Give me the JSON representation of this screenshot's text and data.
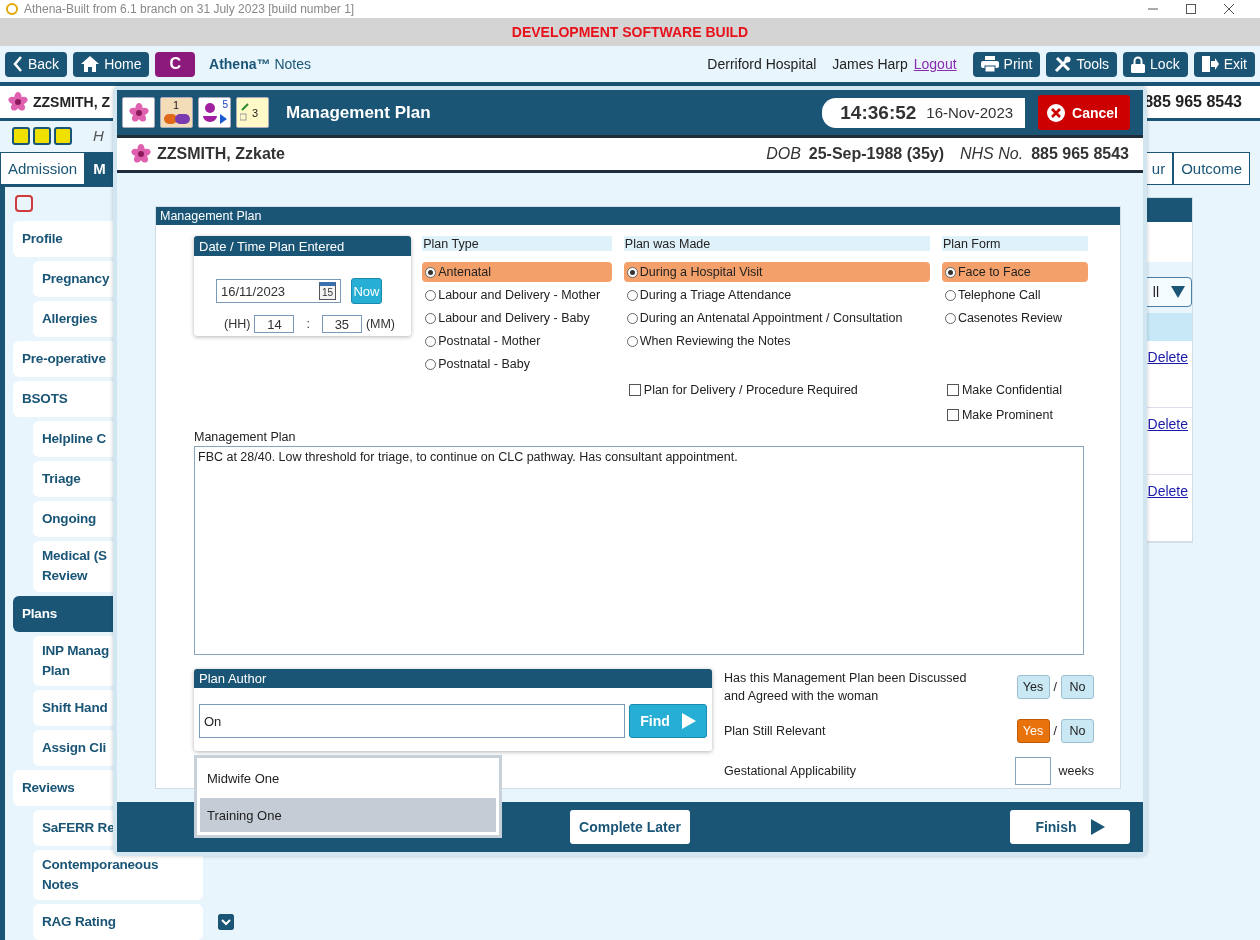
{
  "titlebar": {
    "title": "Athena-Built from 6.1 branch on 31 July 2023 [build number 1]"
  },
  "banner": "DEVELOPMENT SOFTWARE BUILD",
  "toolbar": {
    "left_buttons": [
      {
        "kind": "back",
        "label": "Back"
      },
      {
        "kind": "home",
        "label": "Home"
      },
      {
        "kind": "c",
        "label": "C"
      }
    ],
    "app_name": "Athena™",
    "app_sub": "Notes",
    "hospital": "Derriford Hospital",
    "user": "James Harp",
    "logout": "Logout",
    "right_buttons": [
      {
        "kind": "print",
        "label": "Print"
      },
      {
        "kind": "tools",
        "label": "Tools"
      },
      {
        "kind": "lock",
        "label": "Lock"
      },
      {
        "kind": "exit",
        "label": "Exit"
      }
    ]
  },
  "patient_bar": {
    "name": "ZZSMITH, Z",
    "nhs_number": "885 965 8543"
  },
  "alert_row": {
    "text": "H"
  },
  "tabs_left": [
    {
      "label": "Admission",
      "selected": false
    },
    {
      "label": "M",
      "selected": true
    }
  ],
  "tabs_right": [
    {
      "label": "ur",
      "selected": false
    },
    {
      "label": "Outcome",
      "selected": false
    }
  ],
  "sidebar": {
    "items": [
      {
        "label": "Profile",
        "selected": false,
        "children": [
          {
            "label": "Pregnancy",
            "selected": false
          },
          {
            "label": "Allergies",
            "selected": false
          }
        ]
      },
      {
        "label": "Pre-operative",
        "selected": false
      },
      {
        "label": "BSOTS",
        "selected": false,
        "children": [
          {
            "label": "Helpline C",
            "selected": false
          },
          {
            "label": "Triage",
            "selected": false
          },
          {
            "label": "Ongoing",
            "selected": false
          },
          {
            "label": "Medical (S\nReview",
            "selected": false
          }
        ]
      },
      {
        "label": "Plans",
        "selected": true,
        "children": [
          {
            "label": "INP Manag\nPlan",
            "selected": false
          },
          {
            "label": "Shift Hand",
            "selected": false
          },
          {
            "label": "Assign Cli",
            "selected": false
          }
        ]
      },
      {
        "label": "Reviews",
        "selected": false,
        "children": [
          {
            "label": "SaFERR Re",
            "selected": false
          },
          {
            "label": "Contemporaneous\nNotes",
            "selected": false
          },
          {
            "label": "RAG Rating",
            "selected": false
          }
        ]
      }
    ]
  },
  "content": {
    "filter": "ll",
    "delete_links": [
      "Delete",
      "Delete",
      "Delete"
    ]
  },
  "dialog": {
    "header_icons": [
      {
        "kind": "flower"
      },
      {
        "kind": "pill",
        "count": "1"
      },
      {
        "kind": "person",
        "count": "5"
      },
      {
        "kind": "notes",
        "count": "3"
      }
    ],
    "title": "Management Plan",
    "time": "14:36:52",
    "date": "16-Nov-2023",
    "cancel": "Cancel",
    "patient": {
      "name": "ZZSMITH, Zzkate",
      "dob_label": "DOB",
      "dob": "25-Sep-1988 (35y)",
      "nhs_label": "NHS No.",
      "nhs": "885 965 8543"
    },
    "section_title": "Management Plan",
    "date_box": {
      "title": "Date / Time Plan Entered",
      "date": "16/11/2023",
      "calendar_day": "15",
      "now": "Now",
      "hh_label": "(HH)",
      "hh": "14",
      "colon": ":",
      "mm": "35",
      "mm_label": "(MM)"
    },
    "groups": [
      {
        "title": "Plan Type",
        "options": [
          {
            "label": "Antenatal",
            "selected": true
          },
          {
            "label": "Labour and Delivery - Mother",
            "selected": false
          },
          {
            "label": "Labour and Delivery - Baby",
            "selected": false
          },
          {
            "label": "Postnatal - Mother",
            "selected": false
          },
          {
            "label": "Postnatal - Baby",
            "selected": false
          }
        ]
      },
      {
        "title": "Plan was Made",
        "options": [
          {
            "label": "During a Hospital Visit",
            "selected": true
          },
          {
            "label": "During a Triage Attendance",
            "selected": false
          },
          {
            "label": "During an Antenatal Appointment / Consultation",
            "selected": false
          },
          {
            "label": "When Reviewing the Notes",
            "selected": false
          }
        ],
        "checkboxes": [
          {
            "label": "Plan for Delivery / Procedure Required",
            "checked": false
          }
        ]
      },
      {
        "title": "Plan Form",
        "options": [
          {
            "label": "Face to Face",
            "selected": true
          },
          {
            "label": "Telephone Call",
            "selected": false
          },
          {
            "label": "Casenotes Review",
            "selected": false
          }
        ],
        "checkboxes": [
          {
            "label": "Make Confidential",
            "checked": false
          },
          {
            "label": "Make Prominent",
            "checked": false
          }
        ]
      }
    ],
    "notes_label": "Management Plan",
    "notes": "FBC at 28/40. Low threshold for triage, to continue on CLC pathway. Has consultant appointment.",
    "author": {
      "title": "Plan Author",
      "value": "On",
      "find": "Find",
      "suggestions": [
        {
          "label": "Midwife One",
          "selected": false
        },
        {
          "label": "Training One",
          "selected": true
        }
      ]
    },
    "questions": [
      {
        "kind": "yesno",
        "label": "Has this Management Plan been Discussed\nand Agreed with the woman",
        "separator": "/",
        "options": [
          {
            "label": "Yes",
            "selected": false
          },
          {
            "label": "No",
            "selected": false
          }
        ]
      },
      {
        "kind": "yesno",
        "label": "Plan Still Relevant",
        "separator": "/",
        "options": [
          {
            "label": "Yes",
            "selected": true
          },
          {
            "label": "No",
            "selected": false
          }
        ]
      },
      {
        "kind": "weeks",
        "label": "Gestational Applicability",
        "unit": "weeks"
      }
    ],
    "footer": {
      "complete_later": "Complete Later",
      "finish": "Finish"
    }
  }
}
